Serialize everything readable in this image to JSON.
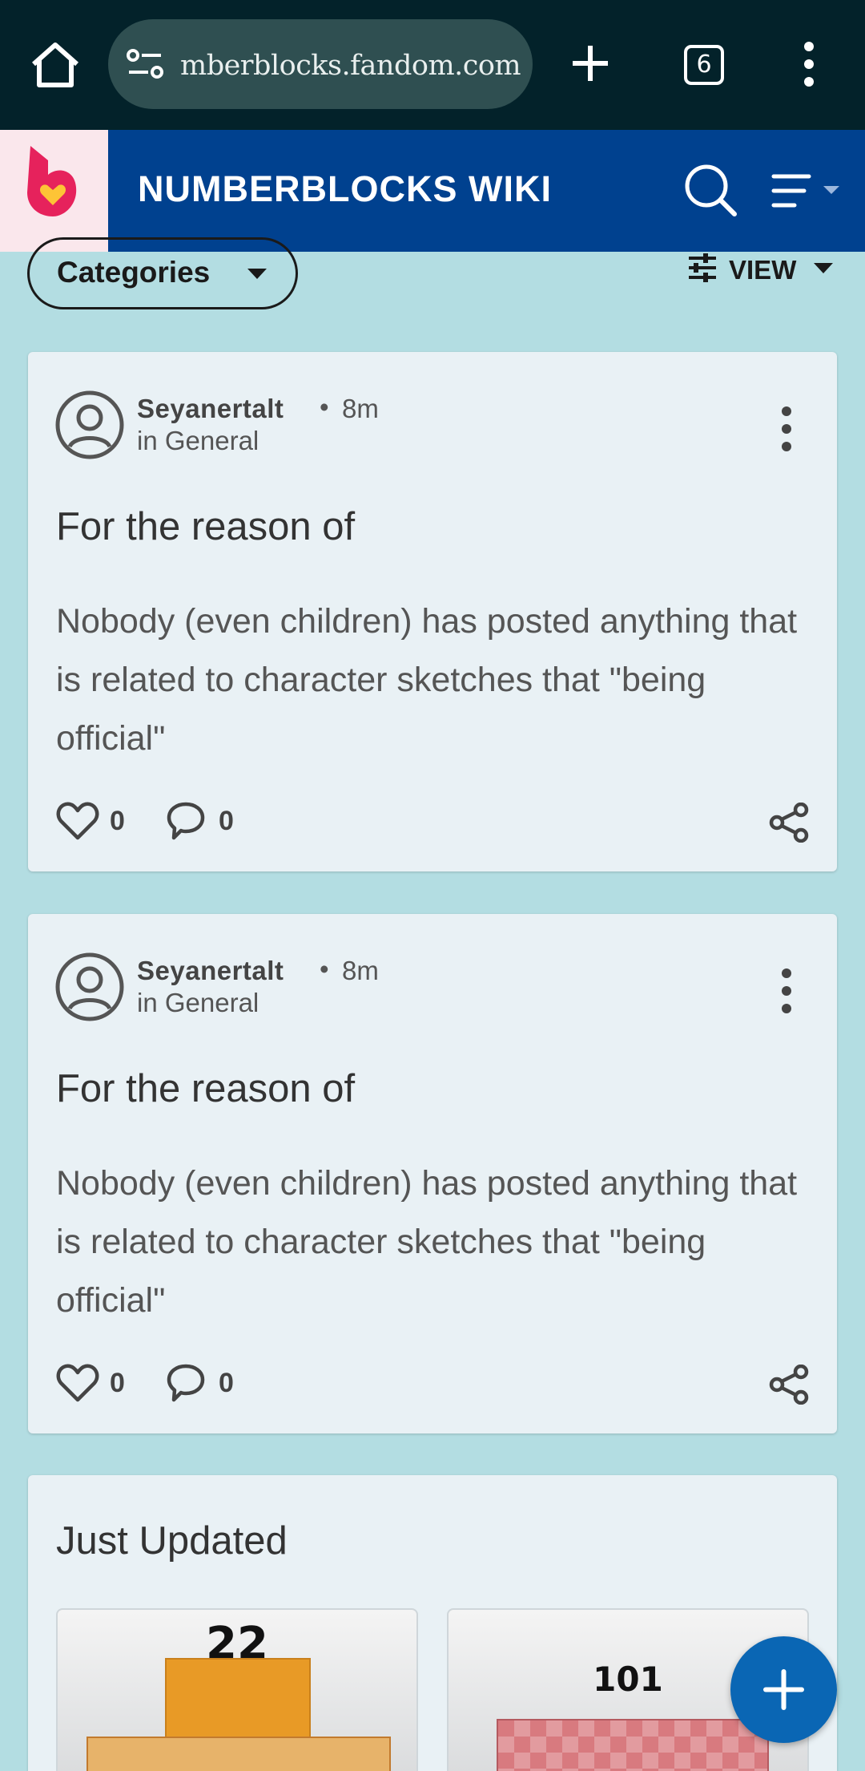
{
  "browser": {
    "url": "mberblocks.fandom.com",
    "tab_count": "6"
  },
  "wiki": {
    "title": "NUMBERBLOCKS WIKI"
  },
  "filters": {
    "categories_label": "Categories",
    "view_label": "VIEW"
  },
  "posts": [
    {
      "author": "Seyanertalt",
      "separator": "•",
      "time": "8m",
      "category": "in General",
      "title": "For the reason of",
      "body": "Nobody (even children) has posted anything that is related to character sketches that \"being official\"",
      "likes": "0",
      "comments": "0"
    },
    {
      "author": "Seyanertalt",
      "separator": "•",
      "time": "8m",
      "category": "in General",
      "title": "For the reason of",
      "body": "Nobody (even children) has posted anything that is related to character sketches that \"being official\"",
      "likes": "0",
      "comments": "0"
    }
  ],
  "just_updated": {
    "title": "Just Updated",
    "items": [
      {
        "label": "22"
      },
      {
        "label": "101"
      }
    ]
  },
  "colors": {
    "chrome_bg": "#03222a",
    "wiki_bar": "#00418f",
    "page_bg": "#b3dde2",
    "card_bg": "#e9f1f5",
    "fab": "#0a66b4",
    "fandom_logo": "#e6225c"
  },
  "icons": [
    "home-icon",
    "site-settings-icon",
    "new-tab-icon",
    "tab-switcher-icon",
    "overflow-menu-icon",
    "fandom-logo",
    "search-icon",
    "hamburger-menu-icon",
    "caret-down-icon",
    "sliders-icon",
    "user-avatar-icon",
    "more-vertical-icon",
    "heart-icon",
    "comment-icon",
    "share-icon",
    "plus-icon"
  ]
}
